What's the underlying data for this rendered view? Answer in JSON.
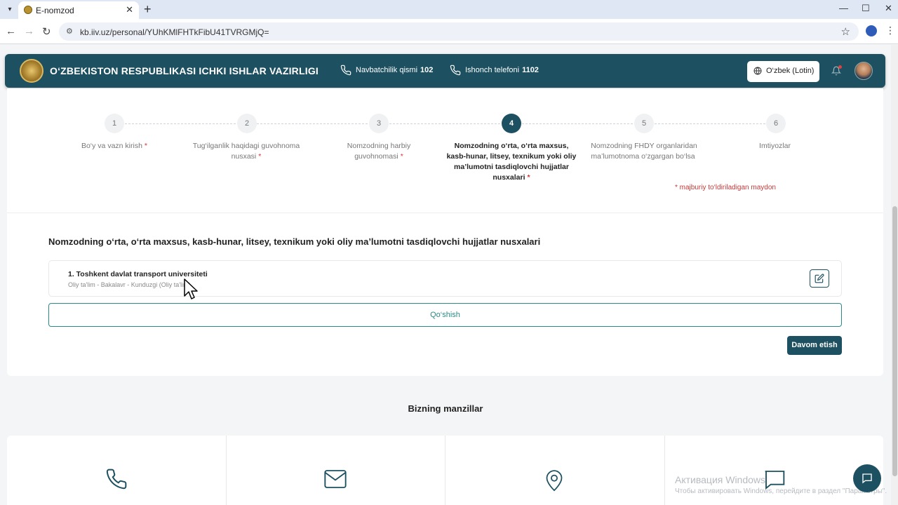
{
  "browser": {
    "tab_title": "E-nomzod",
    "url": "kb.iiv.uz/personal/YUhKMlFHTkFibU41TVRGMjQ="
  },
  "header": {
    "org_title": "O‘ZBEKISTON RESPUBLIKASI ICHKI ISHLAR VAZIRLIGI",
    "duty_label": "Navbatchilik qismi",
    "duty_number": "102",
    "trust_label": "Ishonch telefoni",
    "trust_number": "1102",
    "language": "O‘zbek (Lotin)"
  },
  "steps": [
    {
      "num": "1",
      "label": "Bo‘y va vazn kirish",
      "required": "*"
    },
    {
      "num": "2",
      "label": "Tug‘ilganlik haqidagi guvohnoma nusxasi",
      "required": "*"
    },
    {
      "num": "3",
      "label": "Nomzodning harbiy guvohnomasi",
      "required": "*"
    },
    {
      "num": "4",
      "label": "Nomzodning o‘rta, o‘rta maxsus, kasb-hunar, litsey, texnikum yoki oliy ma’lumotni tasdiqlovchi hujjatlar nusxalari",
      "required": "*"
    },
    {
      "num": "5",
      "label": "Nomzodning FHDY organlaridan ma’lumotnoma o‘zgargan bo‘lsa",
      "required": ""
    },
    {
      "num": "6",
      "label": "Imtiyozlar",
      "required": ""
    }
  ],
  "required_note": "* majburiy to‘ldiriladigan maydon",
  "section": {
    "title": "Nomzodning o‘rta, o‘rta maxsus, kasb-hunar, litsey, texnikum yoki oliy ma’lumotni tasdiqlovchi hujjatlar nusxalari",
    "document": {
      "name": "1. Toshkent davlat transport universiteti",
      "details": "Oliy ta'lim - Bakalavr - Kunduzgi (Oliy ta'lim)"
    },
    "add_label": "Qo‘shish",
    "continue_label": "Davom etish"
  },
  "addresses": {
    "title": "Bizning manzillar"
  },
  "watermark": {
    "title": "Активация Windows",
    "subtitle": "Чтобы активировать Windows, перейдите в раздел \"Параметры\"."
  },
  "icons": [
    "phone-icon",
    "mail-icon",
    "location-icon",
    "chat-icon",
    "globe-icon",
    "bell-icon",
    "edit-icon"
  ]
}
